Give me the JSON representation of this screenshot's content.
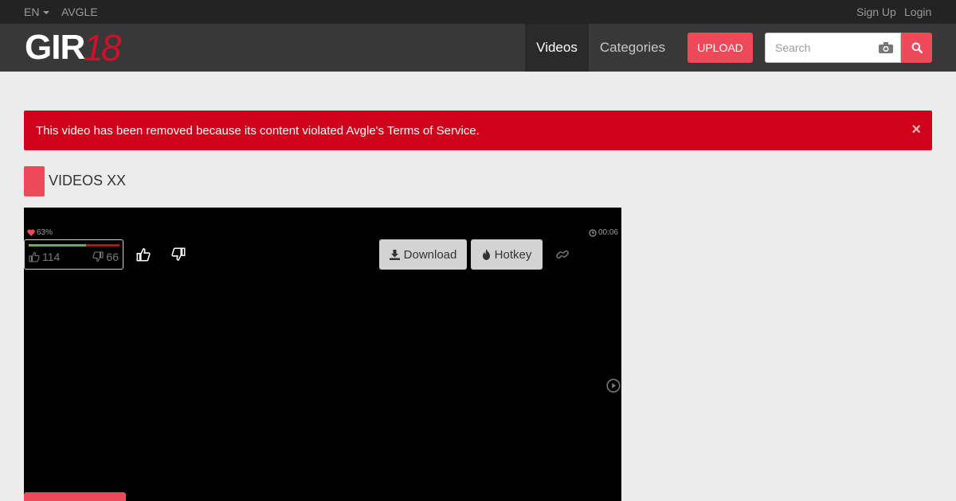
{
  "topbar": {
    "language": "EN",
    "site_link": "AVGLE",
    "signup": "Sign Up",
    "login": "Login"
  },
  "navbar": {
    "logo_text_1": "GIR",
    "logo_text_2": "18",
    "videos": "Videos",
    "categories": "Categories",
    "upload": "UPLOAD",
    "search_placeholder": "Search"
  },
  "alert": {
    "message": "This video has been removed because its content violated Avgle's Terms of Service.",
    "close": "×"
  },
  "section": {
    "title": "VIDEOS XX"
  },
  "player": {
    "rating_percent": "63%",
    "rating_fraction": 0.63,
    "duration": "00:06",
    "likes": "114",
    "dislikes": "66",
    "download_label": "Download",
    "hotkey_label": "Hotkey"
  },
  "colors": {
    "accent": "#ed4958",
    "alert": "#d0021b",
    "good": "#6ab04c"
  },
  "icons": [
    "heart-icon",
    "clock-icon",
    "thumbs-up-icon",
    "thumbs-down-icon",
    "download-icon",
    "fire-icon",
    "link-icon",
    "play-circle-icon",
    "camera-icon",
    "search-icon",
    "caret-down-icon"
  ]
}
